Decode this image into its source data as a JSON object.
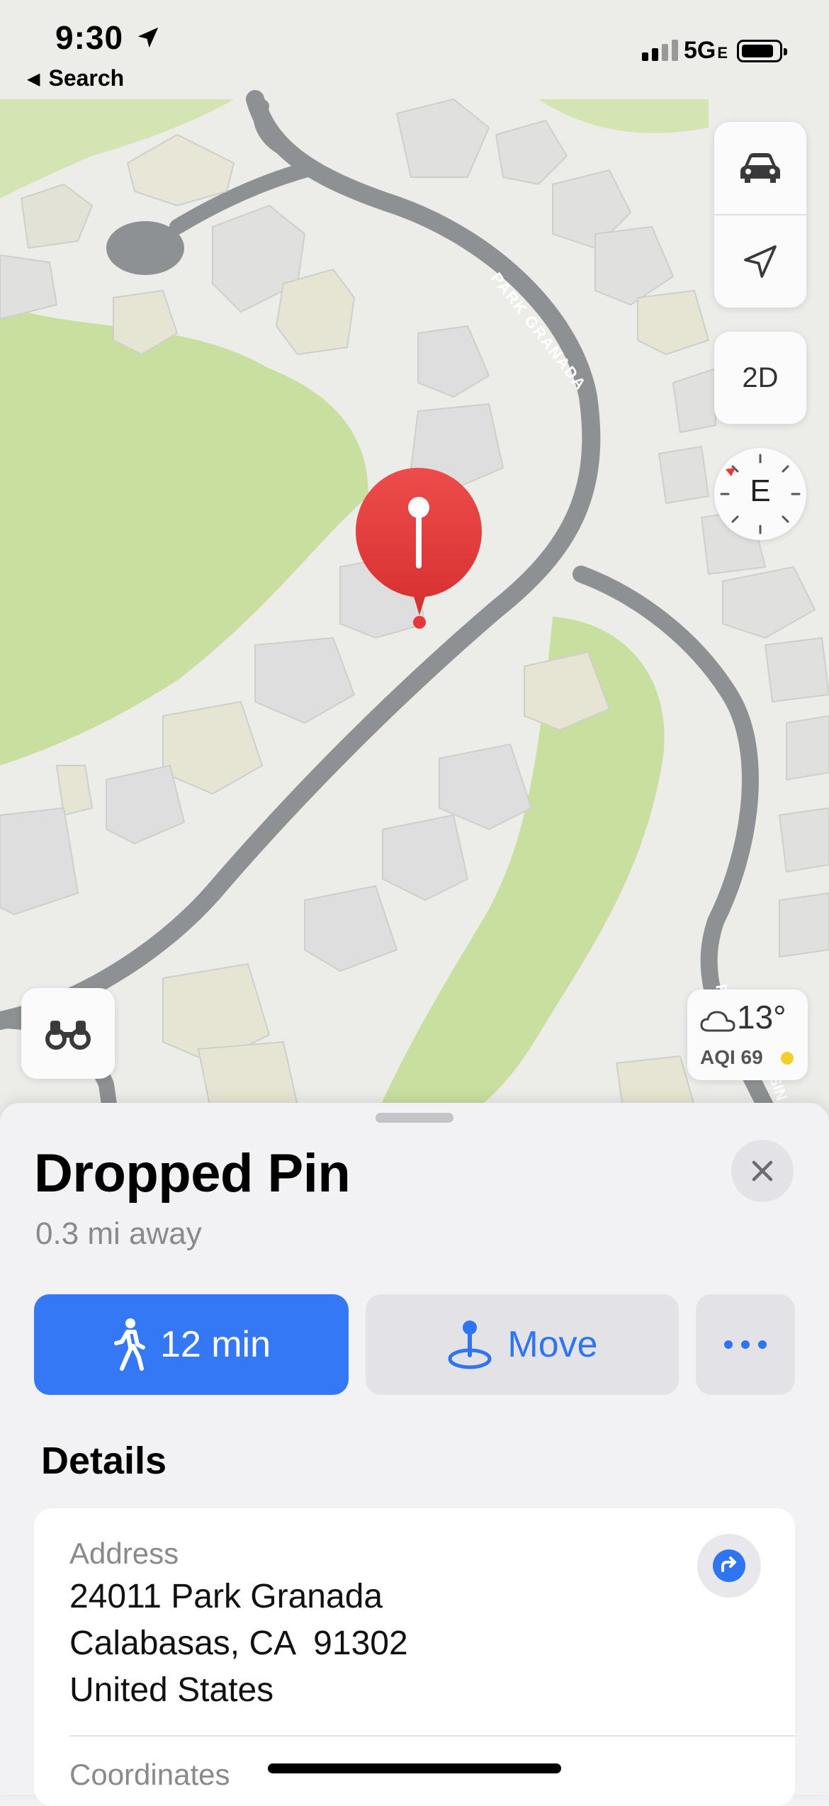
{
  "status_bar": {
    "time": "9:30",
    "back_label": "Search",
    "network": "5G",
    "network_suffix": "E"
  },
  "map": {
    "street_label_1": "PARK GRANADA",
    "street_label_2": "P",
    "street_label_3": "SIN",
    "compass_heading": "E",
    "view_mode_label": "2D",
    "weather_temp": "13°",
    "aqi_label": "AQI 69",
    "colors": {
      "road": "#8e9193",
      "land": "#ededeb",
      "park": "#c9df9f",
      "pin": "#e8373a"
    }
  },
  "sheet": {
    "title": "Dropped Pin",
    "subtitle": "0.3 mi away",
    "walk_button_label": "12 min",
    "move_button_label": "Move",
    "details_heading": "Details",
    "address_label": "Address",
    "address_lines": [
      "24011 Park Granada",
      "Calabasas, CA  91302",
      "United States"
    ],
    "coordinates_label": "Coordinates",
    "accent_color": "#3478f6"
  }
}
